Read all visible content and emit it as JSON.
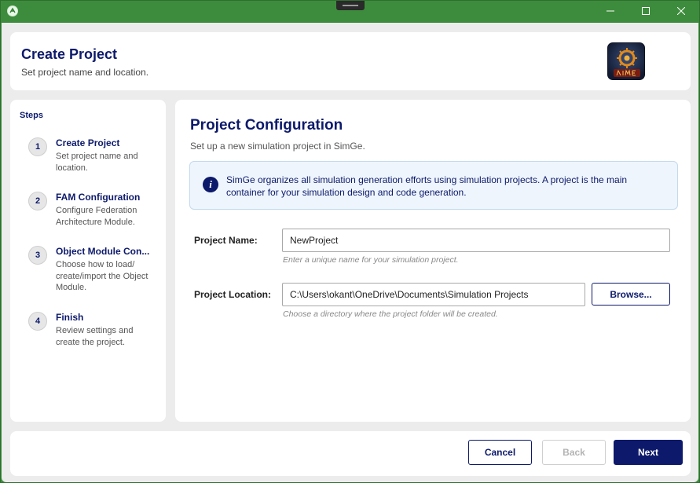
{
  "window": {
    "controls": {
      "minimize_icon": "minimize-icon",
      "maximize_icon": "maximize-icon",
      "close_icon": "close-icon"
    }
  },
  "header": {
    "title": "Create Project",
    "subtitle": "Set project name and location.",
    "logo_icon": "simge-logo"
  },
  "steps": {
    "title": "Steps",
    "items": [
      {
        "number": "1",
        "title": "Create Project",
        "description": "Set project name and location."
      },
      {
        "number": "2",
        "title": "FAM Configuration",
        "description": "Configure Federation Architecture Module."
      },
      {
        "number": "3",
        "title": "Object Module Con...",
        "description": "Choose how to load/ create/import the Object Module."
      },
      {
        "number": "4",
        "title": "Finish",
        "description": "Review settings and create the project."
      }
    ]
  },
  "main": {
    "title": "Project Configuration",
    "subtitle": "Set up a new simulation project in SimGe.",
    "info": {
      "icon": "info-icon",
      "text": "SimGe organizes all simulation generation efforts using simulation projects. A project is the main container for your simulation design and code generation."
    },
    "project_name": {
      "label": "Project Name:",
      "value": "NewProject",
      "hint": "Enter a unique name for your simulation project."
    },
    "project_location": {
      "label": "Project Location:",
      "value": "C:\\Users\\okant\\OneDrive\\Documents\\Simulation Projects",
      "hint": "Choose a directory where the project folder will be created.",
      "browse_label": "Browse..."
    }
  },
  "footer": {
    "cancel_label": "Cancel",
    "back_label": "Back",
    "next_label": "Next"
  },
  "colors": {
    "titlebar": "#3d8c3d",
    "accent": "#0d1a6b",
    "info_bg": "#eef5fc"
  }
}
